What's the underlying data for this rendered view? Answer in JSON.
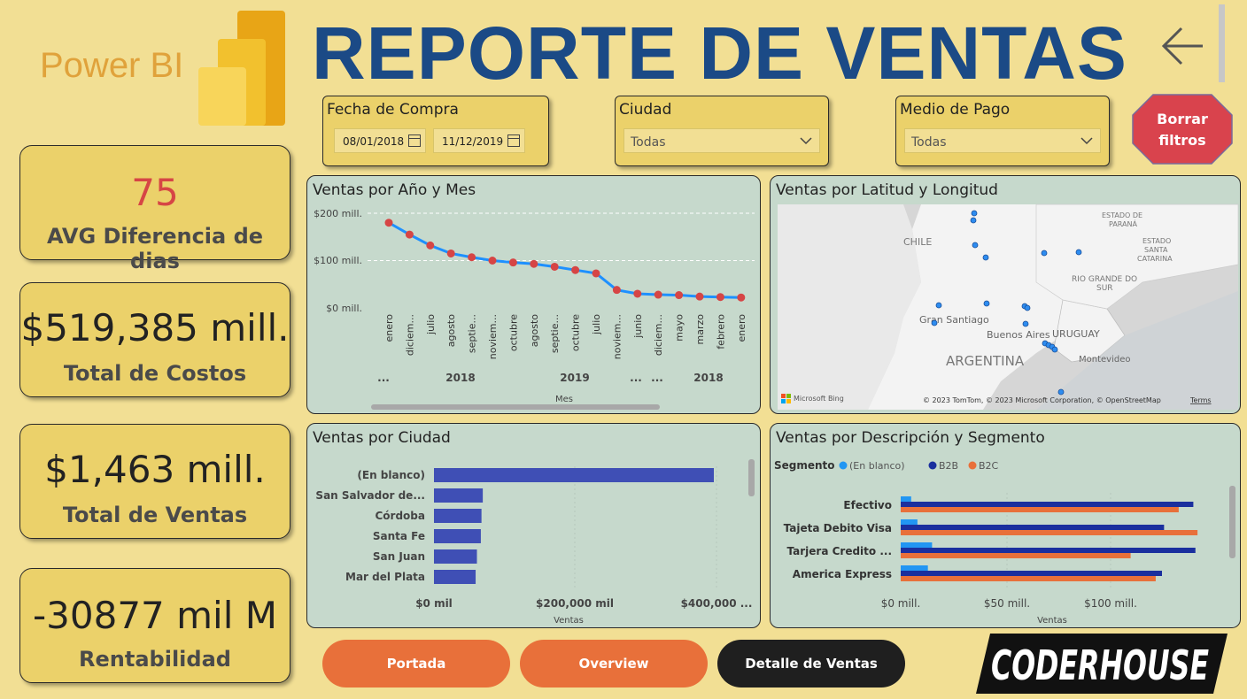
{
  "logo": {
    "text": "Power BI"
  },
  "title": "REPORTE DE VENTAS",
  "filters": {
    "fecha": {
      "label": "Fecha de Compra",
      "start": "08/01/2018",
      "end": "11/12/2019"
    },
    "ciudad": {
      "label": "Ciudad",
      "value": "Todas"
    },
    "medio": {
      "label": "Medio de Pago",
      "value": "Todas"
    },
    "clear_button": {
      "line1": "Borrar",
      "line2": "filtros",
      "color": "#d9434d"
    }
  },
  "kpis": [
    {
      "value": "75",
      "label": "AVG Diferencia de dias"
    },
    {
      "value": "$519,385 mill.",
      "label": "Total de Costos"
    },
    {
      "value": "$1,463 mill.",
      "label": "Total de Ventas"
    },
    {
      "value": "-30877 mil M",
      "label": "Rentabilidad"
    }
  ],
  "line_panel": {
    "title": "Ventas por Año y Mes",
    "yticks": [
      "$200 mill.",
      "$100 mill.",
      "$0 mill."
    ],
    "xlabel": "Mes",
    "months": [
      "enero",
      "diciem...",
      "julio",
      "agosto",
      "septie...",
      "noviem...",
      "octubre",
      "agosto",
      "septie...",
      "octubre",
      "julio",
      "noviem...",
      "junio",
      "diciem...",
      "mayo",
      "marzo",
      "febrero",
      "enero"
    ],
    "year_labels": [
      "...",
      "2018",
      "2019",
      "...",
      "...",
      "2018"
    ]
  },
  "map_panel": {
    "title": "Ventas por Latitud y Longitud",
    "labels": {
      "chile": "CHILE",
      "parana1": "ESTADO DE",
      "parana2": "PARANÁ",
      "sc1": "ESTADO",
      "sc2": "SANTA",
      "sc3": "CATARINA",
      "rgs1": "RIO GRANDE DO",
      "rgs2": "SUR",
      "santiago": "Gran Santiago",
      "ba": "Buenos Aires",
      "uruguay": "URUGUAY",
      "argentina": "ARGENTINA",
      "montevideo": "Montevideo"
    },
    "bing": "Microsoft Bing",
    "credits": "© 2023 TomTom, © 2023 Microsoft Corporation, © OpenStreetMap",
    "terms": "Terms"
  },
  "city_panel": {
    "title": "Ventas por Ciudad",
    "xlabel": "Ventas",
    "xticks": [
      "$0 mil",
      "$200,000 mil",
      "$400,000 ..."
    ]
  },
  "seg_panel": {
    "title": "Ventas por Descripción y Segmento",
    "legend_title": "Segmento",
    "xlabel": "Ventas",
    "xticks": [
      "$0 mill.",
      "$50 mill.",
      "$100 mill."
    ]
  },
  "nav": {
    "portada": "Portada",
    "overview": "Overview",
    "detalle": "Detalle de Ventas"
  },
  "brand": "CODERHOUSE",
  "colors": {
    "accent_title": "#1b4a86",
    "panel_bg": "#c6d9cc",
    "card_bg": "#ebd16a",
    "page_bg": "#f2df94",
    "nav_orange": "#e8703a",
    "nav_dark": "#1f1f1f"
  },
  "chart_data": [
    {
      "type": "line",
      "title": "Ventas por Año y Mes",
      "xlabel": "Mes",
      "ylim": [
        0,
        200
      ],
      "x": [
        "enero",
        "diciem...",
        "julio",
        "agosto",
        "septie...",
        "noviem...",
        "octubre",
        "agosto",
        "septie...",
        "octubre",
        "julio",
        "noviem...",
        "junio",
        "diciem...",
        "mayo",
        "marzo",
        "febrero",
        "enero"
      ],
      "values": [
        180,
        155,
        132,
        115,
        107,
        100,
        96,
        93,
        87,
        80,
        73,
        38,
        30,
        28,
        27,
        24,
        23,
        22
      ],
      "series_color": "#1e90ff",
      "point_color": "#d64545"
    },
    {
      "type": "bar",
      "title": "Ventas por Ciudad",
      "xlabel": "Ventas",
      "categories": [
        "(En blanco)",
        "San Salvador de...",
        "Córdoba",
        "Santa Fe",
        "San Juan",
        "Mar del Plata"
      ],
      "values": [
        432000,
        75000,
        73000,
        72000,
        66000,
        64000
      ],
      "xlim": [
        0,
        430000
      ],
      "color": "#3f4fb5"
    },
    {
      "type": "bar",
      "title": "Ventas por Descripción y Segmento",
      "xlabel": "Ventas",
      "categories": [
        "Efectivo",
        "Tajeta Debito Visa",
        "Tarjera Credito ...",
        "America Express"
      ],
      "series": [
        {
          "name": "(En blanco)",
          "color": "#2196f3",
          "values": [
            5,
            8,
            15,
            13
          ]
        },
        {
          "name": "B2B",
          "color": "#1a2f9e",
          "values": [
            140,
            126,
            141,
            125
          ]
        },
        {
          "name": "B2C",
          "color": "#e8703a",
          "values": [
            133,
            142,
            110,
            122
          ]
        }
      ],
      "xlim": [
        0,
        150
      ]
    }
  ]
}
